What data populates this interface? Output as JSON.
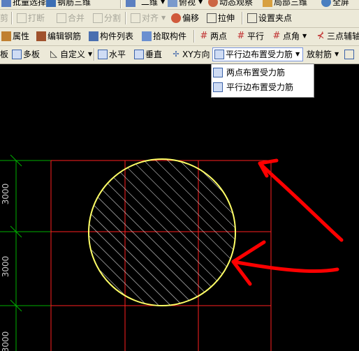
{
  "toolbar_row1": {
    "batch_select": "批量选择",
    "rebar_3d": "钢筋三维",
    "view_2d": "二维",
    "view_top": "俯视",
    "dynamic_observe": "动态观察",
    "local_3d": "局部三维",
    "full_screen": "全屏"
  },
  "toolbar_row2": {
    "cut": "剪",
    "break": "打断",
    "merge": "合并",
    "split": "分割",
    "align": "对齐",
    "offset": "偏移",
    "stretch": "拉伸",
    "set_grip": "设置夹点"
  },
  "toolbar_row3": {
    "properties": "属性",
    "edit_rebar": "编辑钢筋",
    "component_list": "构件列表",
    "pick_component": "拾取构件",
    "two_points": "两点",
    "parallel": "平行",
    "point_angle": "点角",
    "three_point_aux": "三点辅轴"
  },
  "toolbar_row4": {
    "slab": "板",
    "multi_slab": "多板",
    "custom": "自定义",
    "horizontal": "水平",
    "vertical": "垂直",
    "xy_direction": "XY方向",
    "parallel_edge_layout": "平行边布置受力筋",
    "radial_rebar": "放射筋"
  },
  "dropdown": {
    "items": [
      {
        "label": "两点布置受力筋"
      },
      {
        "label": "平行边布置受力筋"
      }
    ]
  },
  "canvas": {
    "dimension_labels": [
      "3000",
      "3000",
      "3000"
    ],
    "colors": {
      "background": "#000000",
      "grid": "#ff2020",
      "axis": "#00b000",
      "slab_outline": "#ffff66",
      "hatch": "#ffffff",
      "annotation": "#ff0000"
    }
  }
}
